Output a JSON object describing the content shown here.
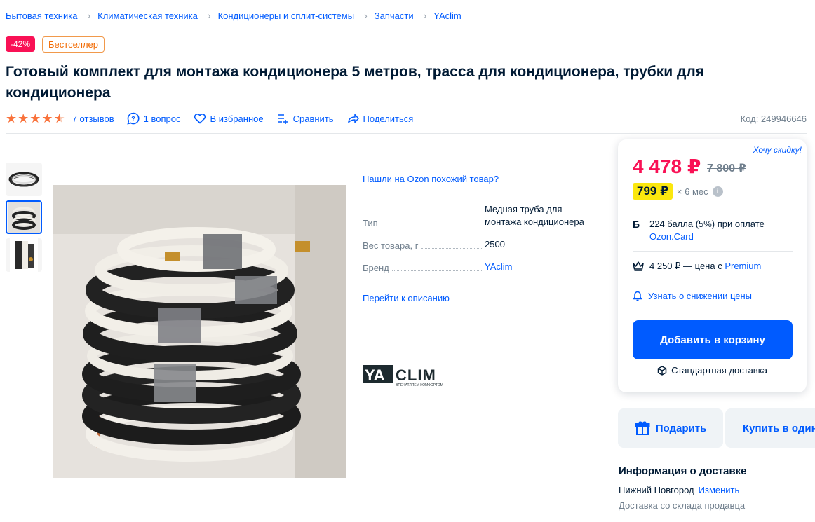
{
  "breadcrumb": [
    "Бытовая техника",
    "Климатическая техника",
    "Кондиционеры и сплит-системы",
    "Запчасти",
    "YAclim"
  ],
  "badges": {
    "discount": "-42%",
    "bestseller": "Бестселлер"
  },
  "title": "Готовый комплект для монтажа кондиционера 5 метров, трасса для кондиционера, трубки для кондиционера",
  "rating": {
    "value": 4.5,
    "reviews": "7 отзывов"
  },
  "actions": {
    "question": "1 вопрос",
    "favorite": "В избранное",
    "compare": "Сравнить",
    "share": "Поделиться"
  },
  "code": "Код: 249946646",
  "similar_link": "Нашли на Ozon похожий товар?",
  "characteristics": [
    {
      "key": "Тип",
      "value": "Медная труба для монтажа кондиционера"
    },
    {
      "key": "Вес товара, г",
      "value": "2500"
    },
    {
      "key": "Бренд",
      "value": "YAclim"
    }
  ],
  "to_description": "Перейти к описанию",
  "brand_logo": {
    "ya": "YA",
    "clim": "CLIM",
    "tagline": "ВПЕЧАТЛЯЕМ КОМФОРТОМ"
  },
  "price": {
    "want_discount": "Хочу скидку!",
    "current": "4 478 ₽",
    "old": "7 800 ₽",
    "installment_price": "799 ₽",
    "installment_term": "× 6 мес",
    "bonus_text": "224 балла (5%) при оплате",
    "bonus_link": "Ozon.Card",
    "premium_text": "4 250 ₽ — цена с",
    "premium_link": "Premium",
    "notify": "Узнать о снижении цены",
    "add_to_cart": "Добавить в корзину",
    "delivery_type": "Стандартная доставка"
  },
  "buttons": {
    "gift": "Подарить",
    "one_click": "Купить в один клик"
  },
  "delivery": {
    "title": "Информация о доставке",
    "city": "Нижний Новгород",
    "change": "Изменить",
    "from": "Доставка со склада продавца"
  },
  "colors": {
    "accent": "#005bff",
    "price": "#f91155",
    "installment": "#fbe70e",
    "star": "#f9723b"
  }
}
